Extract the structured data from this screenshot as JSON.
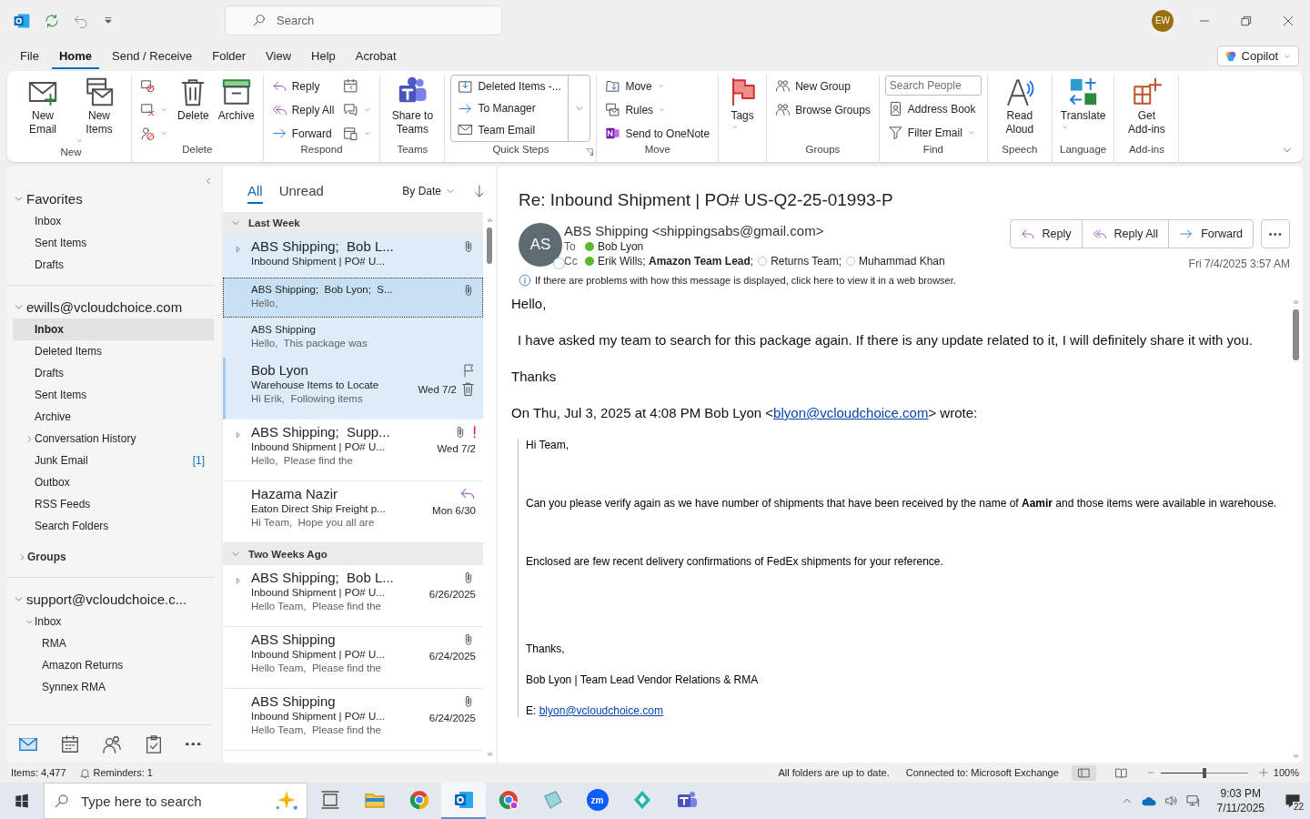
{
  "app_bar": {
    "search": {
      "placeholder": "Search"
    },
    "avatar": "EW"
  },
  "ribbon_tabs": [
    {
      "label": "File",
      "selected": false
    },
    {
      "label": "Home",
      "selected": true
    },
    {
      "label": "Send / Receive",
      "selected": false
    },
    {
      "label": "Folder",
      "selected": false
    },
    {
      "label": "View",
      "selected": false
    },
    {
      "label": "Help",
      "selected": false
    },
    {
      "label": "Acrobat",
      "selected": false
    }
  ],
  "copilot": {
    "label": "Copilot"
  },
  "ribbon": {
    "groups": [
      {
        "label": "New",
        "items": [
          {
            "kind": "large",
            "label": "New Email"
          },
          {
            "kind": "large",
            "label": "New Items",
            "dropdown": true
          }
        ]
      },
      {
        "label": "Delete",
        "items": [
          {
            "kind": "icon"
          },
          {
            "kind": "icon",
            "dropdown": true
          },
          {
            "kind": "icon",
            "dropdown": true
          },
          {
            "kind": "large",
            "label": "Delete"
          },
          {
            "kind": "large",
            "label": "Archive"
          }
        ]
      },
      {
        "label": "Respond",
        "items": [
          {
            "kind": "small",
            "label": "Reply"
          },
          {
            "kind": "small",
            "label": "Reply All"
          },
          {
            "kind": "small",
            "label": "Forward"
          },
          {
            "kind": "icon"
          },
          {
            "kind": "icon",
            "dropdown": true
          },
          {
            "kind": "icon",
            "dropdown": true
          }
        ]
      },
      {
        "label": "Teams",
        "items": [
          {
            "kind": "large",
            "label": "Share to Teams"
          }
        ]
      },
      {
        "label": "Quick Steps",
        "launcher": true,
        "items": [
          {
            "kind": "quickstep",
            "label": "Deleted Items -..."
          },
          {
            "kind": "quickstep",
            "label": "To Manager"
          },
          {
            "kind": "quickstep",
            "label": "Team Email"
          }
        ]
      },
      {
        "label": "Move",
        "items": [
          {
            "kind": "small",
            "label": "Move",
            "dropdown": true
          },
          {
            "kind": "small",
            "label": "Rules",
            "dropdown": true
          },
          {
            "kind": "small",
            "label": "Send to OneNote"
          }
        ]
      },
      {
        "items": [
          {
            "kind": "large",
            "label": "Tags",
            "dropdown": true
          }
        ]
      },
      {
        "label": "Groups",
        "items": [
          {
            "kind": "small",
            "label": "New Group"
          },
          {
            "kind": "small",
            "label": "Browse Groups"
          }
        ]
      },
      {
        "label": "Find",
        "items": [
          {
            "kind": "field",
            "placeholder": "Search People"
          },
          {
            "kind": "small",
            "label": "Address Book"
          },
          {
            "kind": "small",
            "label": "Filter Email",
            "dropdown": true
          }
        ]
      },
      {
        "label": "Speech",
        "items": [
          {
            "kind": "large",
            "label": "Read Aloud"
          }
        ]
      },
      {
        "label": "Language",
        "items": [
          {
            "kind": "large",
            "label": "Translate",
            "dropdown": true
          }
        ]
      },
      {
        "label": "Add-ins",
        "items": [
          {
            "kind": "large",
            "label": "Get Add-ins"
          }
        ]
      }
    ]
  },
  "folder_pane": {
    "sections": [
      {
        "label": "Favorites",
        "expanded": true,
        "children": [
          {
            "label": "Inbox",
            "selected": false
          },
          {
            "label": "Sent Items",
            "selected": false
          },
          {
            "label": "Drafts",
            "selected": false
          }
        ]
      },
      {
        "label": "ewills@vcloudchoice.com",
        "expanded": true,
        "children": [
          {
            "label": "Inbox",
            "selected": true
          },
          {
            "label": "Deleted Items",
            "selected": false
          },
          {
            "label": "Drafts",
            "selected": false
          },
          {
            "label": "Sent Items",
            "selected": false
          },
          {
            "label": "Archive",
            "selected": false
          },
          {
            "label": "Conversation History",
            "selected": false,
            "expanded": false
          },
          {
            "label": "Junk Email",
            "selected": false,
            "count": "[1]"
          },
          {
            "label": "Outbox",
            "selected": false
          },
          {
            "label": "RSS Feeds",
            "selected": false
          },
          {
            "label": "Search Folders",
            "selected": false
          }
        ],
        "groups": {
          "label": "Groups",
          "expanded": false
        }
      },
      {
        "label": "support@vcloudchoice.c...",
        "expanded": true,
        "children": [
          {
            "label": "Inbox",
            "selected": false,
            "expanded": true,
            "children": [
              {
                "label": "RMA",
                "selected": false
              },
              {
                "label": "Amazon Returns",
                "selected": false
              },
              {
                "label": "Synnex RMA",
                "selected": false
              }
            ]
          }
        ]
      }
    ],
    "nav": [
      {
        "selected": true
      },
      {
        "selected": false
      },
      {
        "selected": false
      },
      {
        "selected": false
      },
      {
        "selected": false
      }
    ]
  },
  "message_list": {
    "filters": [
      {
        "label": "All",
        "selected": true
      },
      {
        "label": "Unread",
        "selected": false
      }
    ],
    "sort": "By Date",
    "groups": [
      {
        "label": "Last Week",
        "expanded": true,
        "messages": [
          {
            "kind": "conversation",
            "sender": "ABS Shipping;  Bob L...",
            "subject": "Inbound Shipment | PO# U...",
            "selected": false,
            "highlighted": true,
            "hovered": false,
            "attachment": true,
            "important": false,
            "replied": false
          },
          {
            "kind": "child",
            "sender": "ABS Shipping;  Bob Lyon;  S...",
            "preview": "Hello,",
            "selected": true,
            "highlighted": true,
            "hovered": false,
            "attachment": true,
            "important": false,
            "replied": false
          },
          {
            "kind": "child",
            "sender": "ABS Shipping",
            "preview": "Hello,  This package was",
            "selected": false,
            "highlighted": true,
            "hovered": false,
            "attachment": false,
            "important": false,
            "replied": false
          },
          {
            "kind": "message",
            "sender": "Bob Lyon",
            "subject": "Warehouse Items to Locate",
            "preview": "Hi Erik,  Following items",
            "date": "Wed 7/2",
            "selected": false,
            "highlighted": true,
            "hovered": true,
            "attachment": false,
            "important": false,
            "replied": false
          },
          {
            "kind": "conversation",
            "sender": "ABS Shipping;  Supp...",
            "subject": "Inbound Shipment | PO# U...",
            "preview": "Hello,  Please find the",
            "date": "Wed 7/2",
            "selected": false,
            "highlighted": false,
            "hovered": false,
            "attachment": true,
            "important": true,
            "replied": false
          },
          {
            "kind": "message",
            "sender": "Hazama Nazir",
            "subject": "Eaton Direct Ship Freight p...",
            "preview": "Hi Team,  Hope you all are",
            "date": "Mon 6/30",
            "selected": false,
            "highlighted": false,
            "hovered": false,
            "attachment": false,
            "important": false,
            "replied": true
          }
        ]
      },
      {
        "label": "Two Weeks Ago",
        "expanded": true,
        "messages": [
          {
            "kind": "conversation",
            "sender": "ABS Shipping;  Bob L...",
            "subject": "Inbound Shipment | PO# U...",
            "preview": "Hello Team,  Please find the",
            "date": "6/26/2025",
            "selected": false,
            "highlighted": false,
            "hovered": false,
            "attachment": true,
            "important": false,
            "replied": false
          },
          {
            "kind": "message",
            "sender": "ABS Shipping",
            "subject": "Inbound Shipment | PO# U...",
            "preview": "Hello Team,  Please find the",
            "date": "6/24/2025",
            "selected": false,
            "highlighted": false,
            "hovered": false,
            "attachment": true,
            "important": false,
            "replied": false
          },
          {
            "kind": "message",
            "sender": "ABS Shipping",
            "subject": "Inbound Shipment | PO# U...",
            "preview": "Hello Team,  Please find the",
            "date": "6/24/2025",
            "selected": false,
            "highlighted": false,
            "hovered": false,
            "attachment": true,
            "important": false,
            "replied": false
          }
        ]
      }
    ]
  },
  "reading_pane": {
    "subject": "Re: Inbound Shipment | PO# US-Q2-25-01993-P",
    "avatar": "AS",
    "sender": "ABS Shipping <shippingsabs@gmail.com>",
    "to_label": "To",
    "to": [
      {
        "name": "Bob Lyon",
        "online": true
      }
    ],
    "cc_label": "Cc",
    "cc": [
      {
        "name": "Erik Wills; **Amazon Team Lead**;",
        "online": true
      },
      {
        "name": "Returns Team;",
        "online": false
      },
      {
        "name": "Muhammad Khan",
        "online": false
      }
    ],
    "actions": [
      "Reply",
      "Reply All",
      "Forward"
    ],
    "date": "Fri 7/4/2025 3:57 AM",
    "notice": "If there are problems with how this message is displayed, click here to view it in a web browser.",
    "body": [
      {
        "kind": "text",
        "text": "Hello,"
      },
      {
        "kind": "text",
        "text": "I have asked my team to search for this package again. If there is any update related to it, I will definitely share it with you."
      },
      {
        "kind": "text",
        "text": "Thanks"
      },
      {
        "kind": "attribution",
        "before": "On Thu, Jul 3, 2025 at 4:08 PM Bob Lyon <",
        "link": "blyon@vcloudchoice.com",
        "after": "> wrote:"
      }
    ],
    "quote": [
      {
        "kind": "text",
        "text": "Hi Team,"
      },
      {
        "kind": "text",
        "text": "Can you please verify again as we have number of shipments that have been received by the name of **Aamir** and those items were available in warehouse."
      },
      {
        "kind": "text",
        "text": "Enclosed are few recent delivery confirmations of FedEx shipments for your reference."
      },
      {
        "kind": "text",
        "text": "Thanks,"
      },
      {
        "kind": "text",
        "text": "Bob Lyon | Team Lead Vendor Relations & RMA"
      },
      {
        "kind": "link",
        "label": "E:",
        "link": "blyon@vcloudchoice.com"
      }
    ]
  },
  "status_bar": {
    "items": "Items: 4,477",
    "reminders": "Reminders: 1",
    "sync": "All folders are up to date.",
    "connection": "Connected to: Microsoft Exchange",
    "views": [
      {
        "selected": true
      },
      {
        "selected": false
      }
    ],
    "zoom": {
      "level": 0.5,
      "reading": "100%"
    }
  },
  "taskbar": {
    "search": {
      "placeholder": "Type here to search"
    },
    "apps": [
      {
        "selected": false
      },
      {
        "selected": false
      },
      {
        "selected": false
      },
      {
        "selected": true
      },
      {
        "selected": false
      },
      {
        "selected": false
      },
      {
        "label": "zm",
        "selected": false
      },
      {
        "selected": false
      },
      {
        "selected": false
      }
    ],
    "time": "9:03 PM",
    "date": "7/11/2025",
    "notifications": "22"
  }
}
